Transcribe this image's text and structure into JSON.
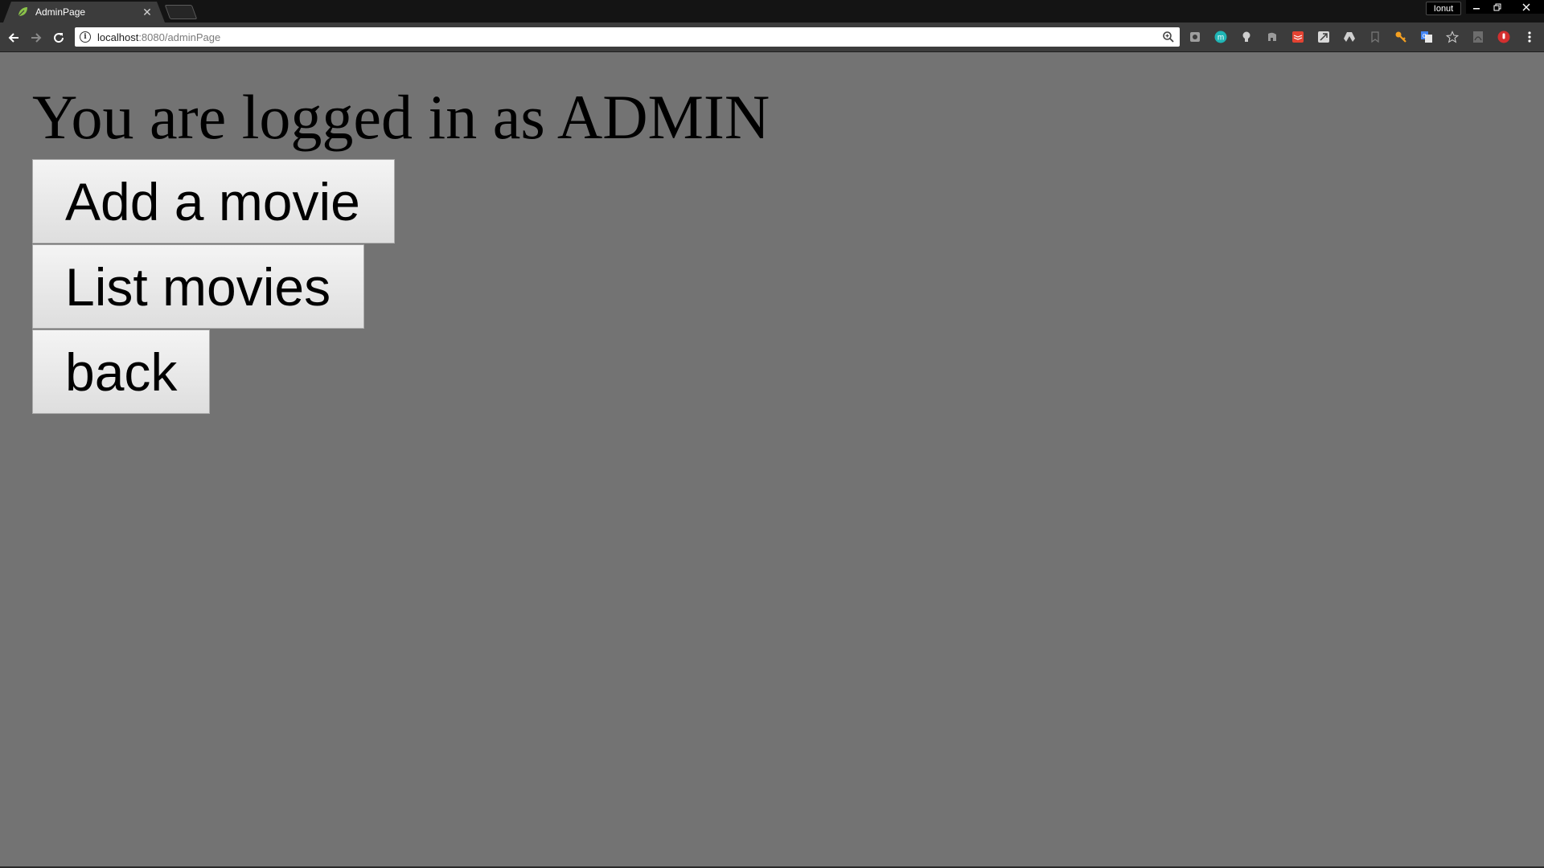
{
  "browser": {
    "tab": {
      "title": "AdminPage",
      "favicon": "leaf-icon",
      "favicon_color": "#8bc34a"
    },
    "profile_name": "Ionut",
    "address_bar": {
      "host": "localhost",
      "port_path": ":8080/adminPage"
    },
    "extensions": [
      "pocket-icon",
      "m-badge-icon",
      "bulb-icon",
      "elephant-icon",
      "todoist-icon",
      "send-icon",
      "drive-icon",
      "bookmark-icon",
      "key-icon",
      "translate-icon",
      "star-icon",
      "pdf-icon",
      "adblock-icon",
      "menu-dots-icon"
    ]
  },
  "page": {
    "heading": "You are logged in as ADMIN",
    "buttons": {
      "add_movie": "Add a movie",
      "list_movies": "List movies",
      "back": "back"
    }
  },
  "colors": {
    "page_background": "#737373",
    "chrome_dark": "#141414",
    "toolbar": "#3c3c3c"
  }
}
